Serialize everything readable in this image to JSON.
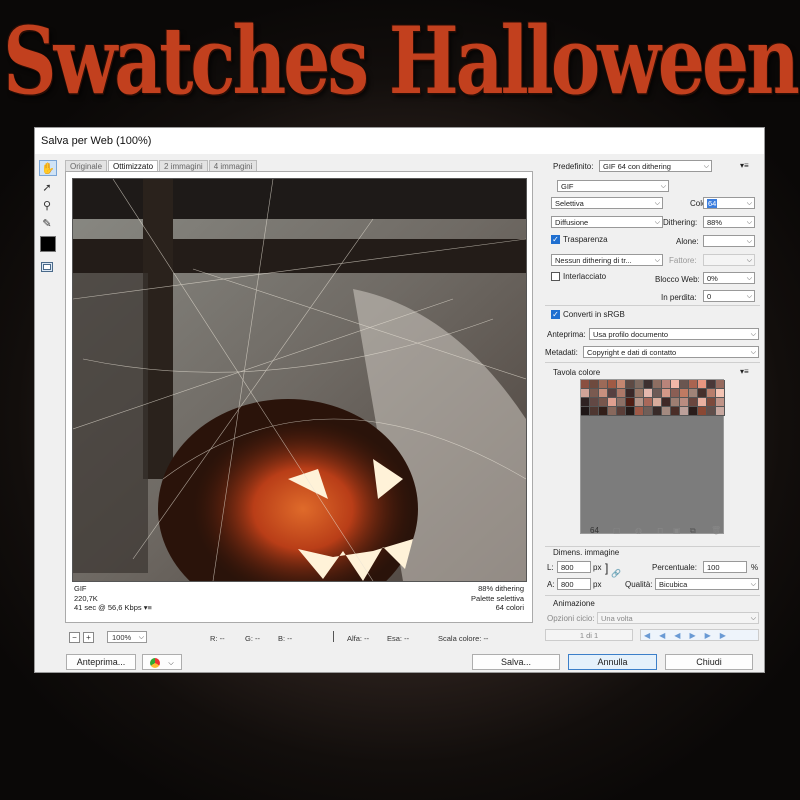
{
  "banner": {
    "title": "Swatches Halloween"
  },
  "dialog": {
    "title": "Salva per Web (100%)"
  },
  "tools": [
    {
      "name": "hand-tool-icon",
      "glyph": "✋"
    },
    {
      "name": "slice-select-tool-icon",
      "glyph": "➚"
    },
    {
      "name": "zoom-tool-icon",
      "glyph": "⚲"
    },
    {
      "name": "eyedropper-tool-icon",
      "glyph": "✎"
    }
  ],
  "tabs": [
    "Originale",
    "Ottimizzato",
    "2 immagini",
    "4 immagini"
  ],
  "preview_info": {
    "left": [
      "GIF",
      "220,7K",
      "41 sec @ 56,6 Kbps"
    ],
    "right": [
      "88% dithering",
      "Palette selettiva",
      "64 colori"
    ]
  },
  "statusbar": {
    "zoom": "100%",
    "r": "R: --",
    "g": "G: --",
    "b": "B: --",
    "alpha": "Alfa: --",
    "hex": "Esa: --",
    "index": "Scala colore: --"
  },
  "settings": {
    "preset_label": "Predefinito:",
    "preset": "GIF 64 con dithering",
    "format": "GIF",
    "reduction": "Selettiva",
    "colors_label": "Colori:",
    "colors": "64",
    "dither_algo": "Diffusione",
    "dithering_label": "Dithering:",
    "dithering": "88%",
    "transparency": "Trasparenza",
    "matte_label": "Alone:",
    "matte": "",
    "trans_dither": "Nessun dithering di tr...",
    "amount_label": "Fattore:",
    "amount": "",
    "interlaced": "Interlacciato",
    "websnap_label": "Blocco Web:",
    "websnap": "0%",
    "lossy_label": "In perdita:",
    "lossy": "0",
    "convert_srgb": "Converti in sRGB",
    "preview_label": "Anteprima:",
    "preview": "Usa profilo documento",
    "metadata_label": "Metadati:",
    "metadata": "Copyright e dati di contatto"
  },
  "color_table": {
    "title": "Tavola colore",
    "count": "64",
    "colors": [
      "#8a5040",
      "#6e4a3e",
      "#9c6a58",
      "#a05a44",
      "#c48670",
      "#5e4a44",
      "#7e6a60",
      "#3e3030",
      "#8e6e62",
      "#b8847a",
      "#f0b8a8",
      "#6a5650",
      "#aa6450",
      "#e89680",
      "#4a3838",
      "#966a5e",
      "#d0a498",
      "#7a5a50",
      "#c8907e",
      "#564040",
      "#ac7868",
      "#3a2828",
      "#9a7868",
      "#e4b8ae",
      "#6e5a56",
      "#d49888",
      "#8a5e54",
      "#c07a62",
      "#a08478",
      "#46302c",
      "#b87e6c",
      "#f4c4b4",
      "#2e2222",
      "#624844",
      "#78564c",
      "#e0a090",
      "#8c7066",
      "#501e14",
      "#b49488",
      "#a8685a",
      "#d8ac9c",
      "#402826",
      "#9c7e72",
      "#ba8c80",
      "#6a463e",
      "#e8b0a0",
      "#7c4a3c",
      "#c09488",
      "#1e1616",
      "#4e3630",
      "#321e18",
      "#88685c",
      "#5a3e38",
      "#241a18",
      "#9e5a48",
      "#705e58",
      "#382a28",
      "#a48a80",
      "#4a2e28",
      "#bca09a",
      "#2a1c1a",
      "#8a4834",
      "#604e4a",
      "#c8a8a0"
    ]
  },
  "image_size": {
    "title": "Dimens. immagine",
    "w_label": "L:",
    "w": "800",
    "w_unit": "px",
    "h_label": "A:",
    "h": "800",
    "h_unit": "px",
    "percent_label": "Percentuale:",
    "percent": "100",
    "percent_unit": "%",
    "quality_label": "Qualità:",
    "quality": "Bicubica"
  },
  "animation": {
    "title": "Animazione",
    "loop_label": "Opzioni cicio:",
    "loop": "Una volta",
    "frame": "1 di 1"
  },
  "buttons": {
    "preview": "Anteprima...",
    "save": "Salva...",
    "cancel": "Annulla",
    "close": "Chiudi"
  }
}
